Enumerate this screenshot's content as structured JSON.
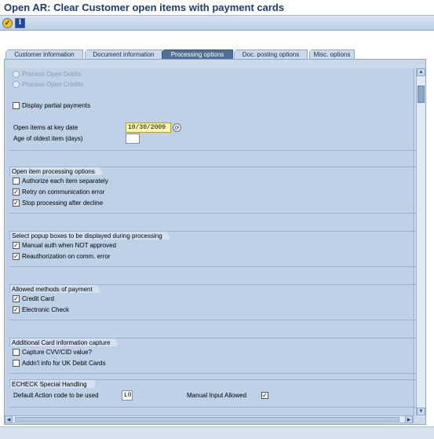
{
  "window": {
    "title": "Open AR: Clear Customer open items with payment cards"
  },
  "toolbar": {
    "execute_icon": "execute-icon",
    "info_icon": "info-icon",
    "info_glyph": "i"
  },
  "tabs": [
    {
      "label": "Customer information"
    },
    {
      "label": "Document information"
    },
    {
      "label": "Processing options",
      "active": true
    },
    {
      "label": "Doc. posting options"
    },
    {
      "label": "Misc. options"
    }
  ],
  "processing": {
    "process_open_debits": "Process Open Debits",
    "process_open_credits": "Process Open Credits",
    "display_partial_payments": "Display partial payments",
    "open_items_key_date_label": "Open items at key date",
    "open_items_key_date_value": "10/30/2009",
    "age_oldest_item_label": "Age of oldest item (days)",
    "age_oldest_item_value": ""
  },
  "open_item_options": {
    "header": "Open item processing options",
    "authorize_each": {
      "label": "Authorize each item separately",
      "checked": false
    },
    "retry_comm_error": {
      "label": "Retry on communication error",
      "checked": true
    },
    "stop_after_decline": {
      "label": "Stop processing after decline",
      "checked": true
    }
  },
  "popup_boxes": {
    "header": "Select popup boxes to be displayed during processing",
    "manual_auth": {
      "label": "Manual auth when NOT approved",
      "checked": true
    },
    "reauthorization": {
      "label": "Reauthorization on comm. error",
      "checked": true
    }
  },
  "payment_methods": {
    "header": "Allowed methods of payment",
    "credit_card": {
      "label": "Credit Card",
      "checked": true
    },
    "electronic_check": {
      "label": "Electronic Check",
      "checked": true
    }
  },
  "card_capture": {
    "header": "Additional Card information capture",
    "capture_cvv": {
      "label": "Capture CVV/CID value?",
      "checked": false
    },
    "uk_debit": {
      "label": "Addn'l info for UK Debit Cards",
      "checked": false
    }
  },
  "echeck": {
    "header": "ECHECK Special Handling",
    "default_action_label": "Default Action code to be used",
    "default_action_value": "L0",
    "manual_input_label": "Manual Input Allowed",
    "manual_input_checked": true
  },
  "colors": {
    "title": "#1c3c74",
    "active_tab": "#4f6f97",
    "panel": "#bed1e7"
  }
}
